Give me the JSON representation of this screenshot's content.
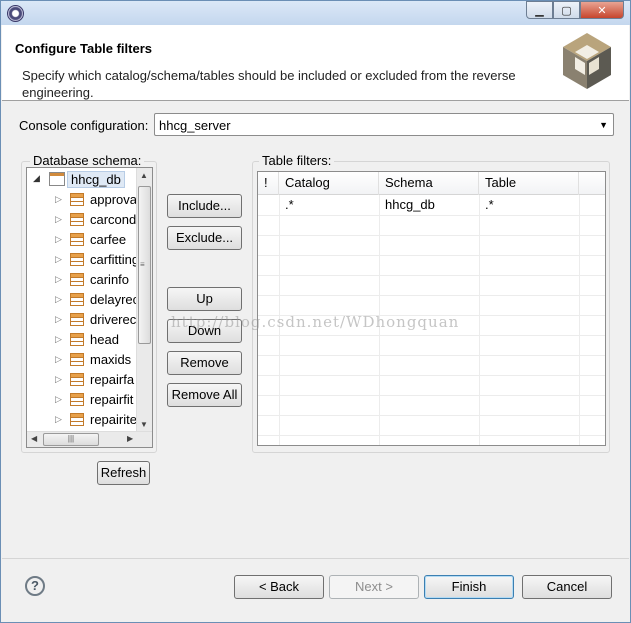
{
  "window": {
    "title": "",
    "buttons": {
      "minimize": "▁",
      "maximize": "▢",
      "close": "✕"
    }
  },
  "banner": {
    "title": "Configure Table filters",
    "description": "Specify which catalog/schema/tables should be included or excluded from the reverse engineering.",
    "logo_icon": "hibernate-logo-icon"
  },
  "console": {
    "label": "Console configuration:",
    "value": "hhcg_server"
  },
  "schema": {
    "label": "Database schema:",
    "root": "hhcg_db",
    "tables": [
      "approva",
      "carcond",
      "carfee",
      "carfitting",
      "carinfo",
      "delayrec",
      "driverec",
      "head",
      "maxids",
      "repairfa",
      "repairfit",
      "repairite"
    ]
  },
  "actions": {
    "include": "Include...",
    "exclude": "Exclude...",
    "up": "Up",
    "down": "Down",
    "remove": "Remove",
    "remove_all": "Remove All",
    "refresh": "Refresh"
  },
  "filters": {
    "label": "Table filters:",
    "columns": [
      "!",
      "Catalog",
      "Schema",
      "Table"
    ],
    "rows": [
      {
        "flag": "",
        "catalog": ".*",
        "schema": "hhcg_db",
        "table": ".*"
      }
    ]
  },
  "watermark": "http://blog.csdn.net/WDhongquan",
  "footer": {
    "help": "?",
    "back": "< Back",
    "next": "Next >",
    "finish": "Finish",
    "cancel": "Cancel"
  },
  "colors": {
    "window_border": "#6b8fb5",
    "selection": "#dfe9f5",
    "table_icon": "#e7a04a"
  }
}
